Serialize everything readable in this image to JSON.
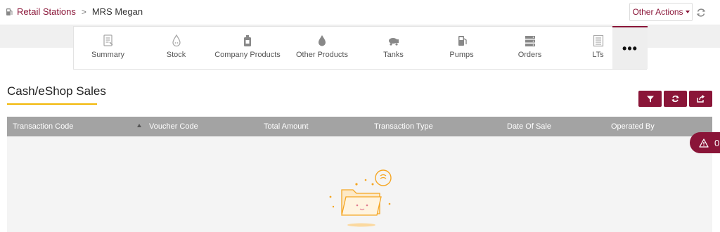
{
  "breadcrumb": {
    "link": "Retail Stations",
    "separator": ">",
    "current": "MRS Megan"
  },
  "header": {
    "other_actions_label": "Other Actions"
  },
  "tabs": [
    {
      "label": "Summary",
      "icon": "summary-doc-icon"
    },
    {
      "label": "Stock",
      "icon": "stock-drop-icon"
    },
    {
      "label": "Company Products",
      "icon": "company-products-bottle-icon"
    },
    {
      "label": "Other Products",
      "icon": "other-products-drop-icon"
    },
    {
      "label": "Tanks",
      "icon": "tank-truck-icon"
    },
    {
      "label": "Pumps",
      "icon": "fuel-pump-icon"
    },
    {
      "label": "Orders",
      "icon": "orders-server-icon"
    },
    {
      "label": "LTs",
      "icon": "lts-list-icon"
    }
  ],
  "more_tab_label": "•••",
  "section": {
    "title": "Cash/eShop Sales"
  },
  "table": {
    "columns": [
      "Transaction Code",
      "Voucher Code",
      "Total Amount",
      "Transaction Type",
      "Date Of Sale",
      "Operated By"
    ]
  },
  "alerts": {
    "count": "0"
  },
  "colors": {
    "brand": "#8a1538",
    "accent_underline": "#f2b705",
    "table_header": "#a3a3a3",
    "empty_state": "#f5a623"
  }
}
